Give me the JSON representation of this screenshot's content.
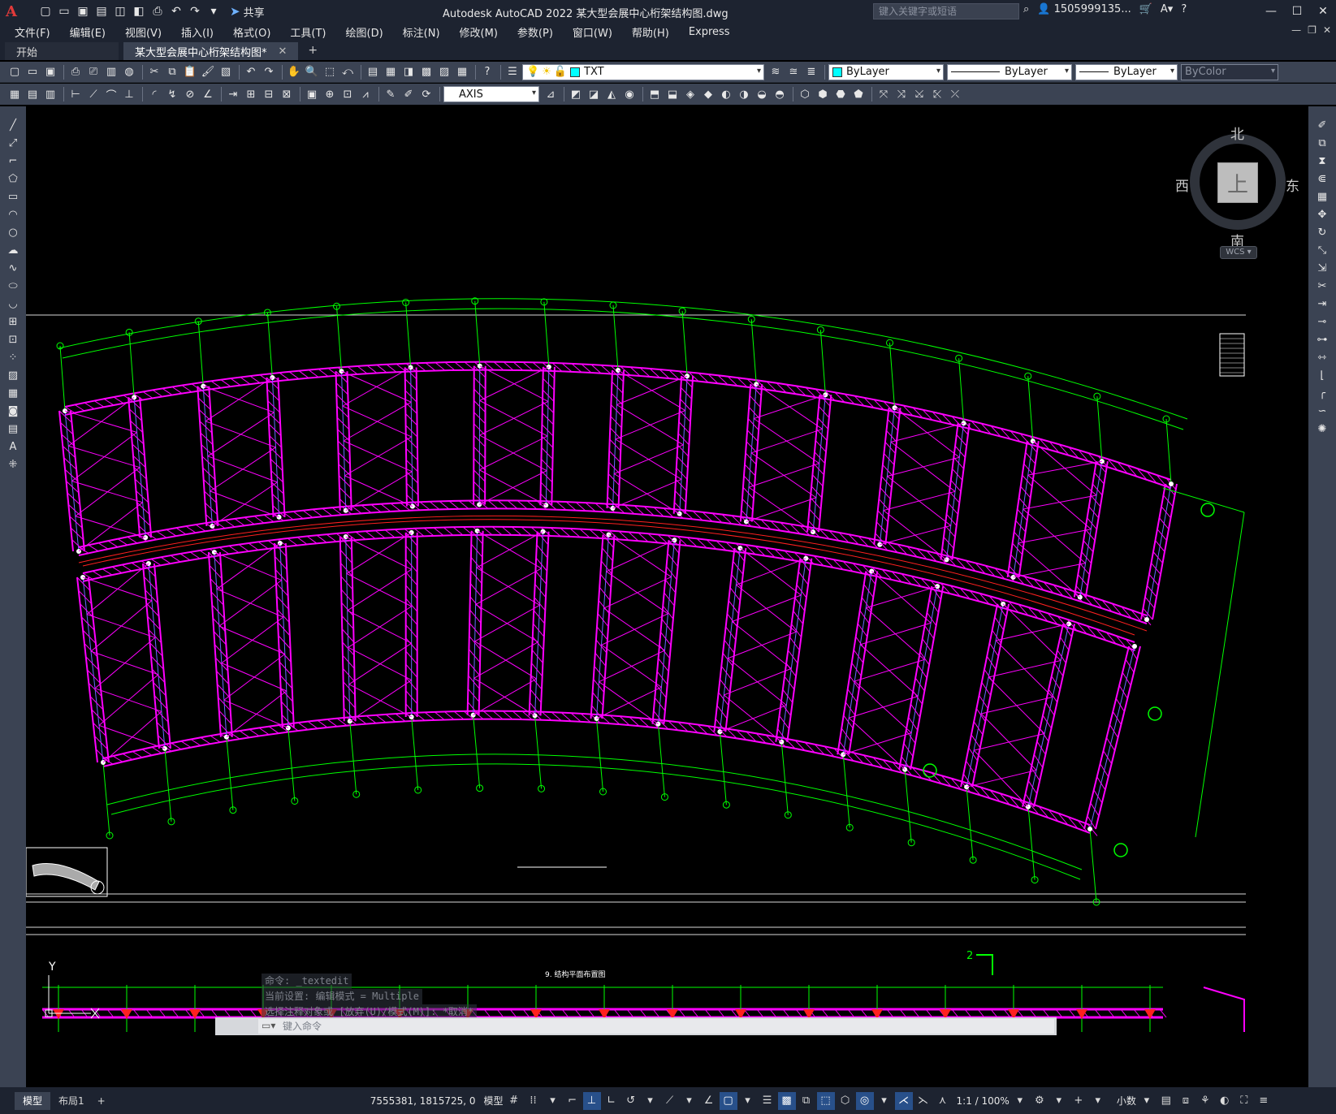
{
  "window": {
    "app_logo": "A",
    "title": "Autodesk AutoCAD 2022    某大型会展中心桁架结构图.dwg",
    "share_label": "共享",
    "search_placeholder": "键入关键字或短语",
    "user": "1505999135...",
    "help": "?"
  },
  "menu": [
    "文件(F)",
    "编辑(E)",
    "视图(V)",
    "插入(I)",
    "格式(O)",
    "工具(T)",
    "绘图(D)",
    "标注(N)",
    "修改(M)",
    "参数(P)",
    "窗口(W)",
    "帮助(H)",
    "Express"
  ],
  "tabs": {
    "start": "开始",
    "active": "某大型会展中心桁架结构图*"
  },
  "toolbar": {
    "layer": "TXT",
    "layer_color": "#00ffff",
    "color": "ByLayer",
    "color_swatch": "#00ffff",
    "linetype": "ByLayer",
    "lineweight": "ByLayer",
    "plotstyle": "ByColor",
    "text_style": "AXIS"
  },
  "viewcube": {
    "north": "北",
    "south": "南",
    "east": "东",
    "west": "西",
    "face": "上",
    "wcs": "WCS"
  },
  "ucs": {
    "y_label": "Y"
  },
  "command": {
    "history": [
      "命令: _textedit",
      "当前设置: 编辑模式 = Multiple",
      "选择注释对象或 [放弃(U)/模式(M)]: *取消*"
    ],
    "placeholder": "键入命令"
  },
  "drawing": {
    "caption": "9. 结构平面布置图",
    "section_mark": "2",
    "accent_magenta": "#ff00ff",
    "accent_green": "#00ff00",
    "accent_red": "#ff2020"
  },
  "status": {
    "layout_tabs": [
      "模型",
      "布局1"
    ],
    "coords": "7555381, 1815725, 0",
    "model_label": "模型",
    "scale": "1:1 / 100%",
    "units": "小数"
  }
}
